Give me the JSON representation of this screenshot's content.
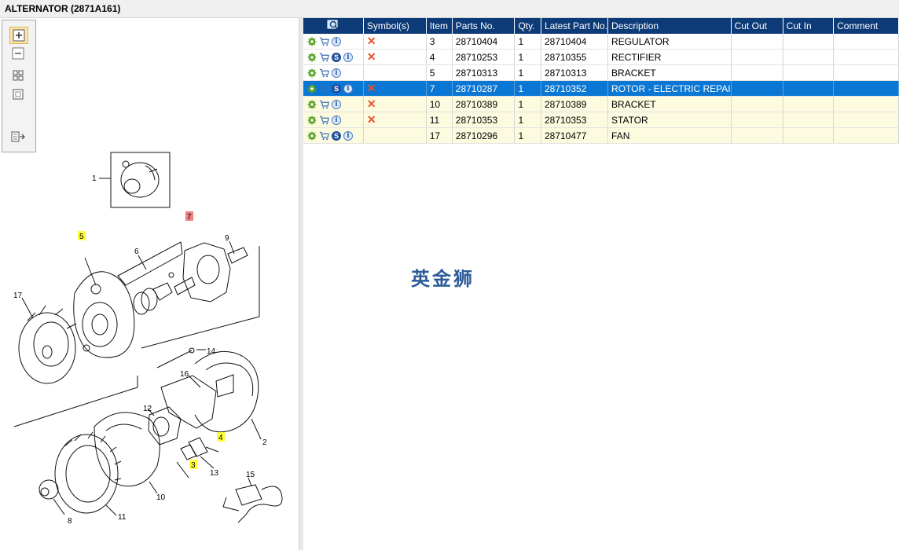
{
  "window": {
    "title": "ALTERNATOR (2871A161)"
  },
  "toolbar": {
    "buttons": [
      {
        "name": "zoom-in-icon"
      },
      {
        "name": "zoom-out-icon"
      },
      {
        "name": "fit-page-icon"
      },
      {
        "name": "actual-size-icon"
      },
      {
        "name": "export-icon"
      }
    ]
  },
  "diagram": {
    "callouts": [
      "1",
      "5",
      "6",
      "7",
      "9",
      "17",
      "14",
      "16",
      "12",
      "2",
      "4",
      "13",
      "3",
      "10",
      "15",
      "11",
      "8"
    ],
    "highlighted": {
      "yellow": [
        "5",
        "4",
        "3"
      ],
      "red": [
        "7"
      ]
    }
  },
  "table": {
    "columns": [
      "",
      "Symbol(s)",
      "Item",
      "Parts No.",
      "Qty.",
      "Latest Part No.",
      "Description",
      "Cut Out",
      "Cut In",
      "Comment"
    ],
    "rows": [
      {
        "has_s": false,
        "symbol": "x",
        "item": "3",
        "part": "28710404",
        "qty": "1",
        "latest": "28710404",
        "desc": "REGULATOR",
        "cut_out": "",
        "cut_in": "",
        "comment": ""
      },
      {
        "has_s": true,
        "symbol": "x",
        "item": "4",
        "part": "28710253",
        "qty": "1",
        "latest": "28710355",
        "desc": "RECTIFIER",
        "cut_out": "",
        "cut_in": "",
        "comment": ""
      },
      {
        "has_s": false,
        "symbol": "",
        "item": "5",
        "part": "28710313",
        "qty": "1",
        "latest": "28710313",
        "desc": "BRACKET",
        "cut_out": "",
        "cut_in": "",
        "comment": ""
      },
      {
        "has_s": true,
        "symbol": "x",
        "item": "7",
        "part": "28710287",
        "qty": "1",
        "latest": "28710352",
        "desc": "ROTOR - ELECTRIC REPAI",
        "cut_out": "",
        "cut_in": "",
        "comment": "",
        "selected": true
      },
      {
        "has_s": false,
        "symbol": "x",
        "item": "10",
        "part": "28710389",
        "qty": "1",
        "latest": "28710389",
        "desc": "BRACKET",
        "cut_out": "",
        "cut_in": "",
        "comment": ""
      },
      {
        "has_s": false,
        "symbol": "x",
        "item": "11",
        "part": "28710353",
        "qty": "1",
        "latest": "28710353",
        "desc": "STATOR",
        "cut_out": "",
        "cut_in": "",
        "comment": ""
      },
      {
        "has_s": true,
        "symbol": "",
        "item": "17",
        "part": "28710296",
        "qty": "1",
        "latest": "28710477",
        "desc": "FAN",
        "cut_out": "",
        "cut_in": "",
        "comment": ""
      }
    ]
  },
  "watermark": "英金狮",
  "colors": {
    "header": "#0d3b78",
    "selected": "#0b77d4",
    "alt_row": "#fdfbdf",
    "x_mark": "#e8522c"
  }
}
